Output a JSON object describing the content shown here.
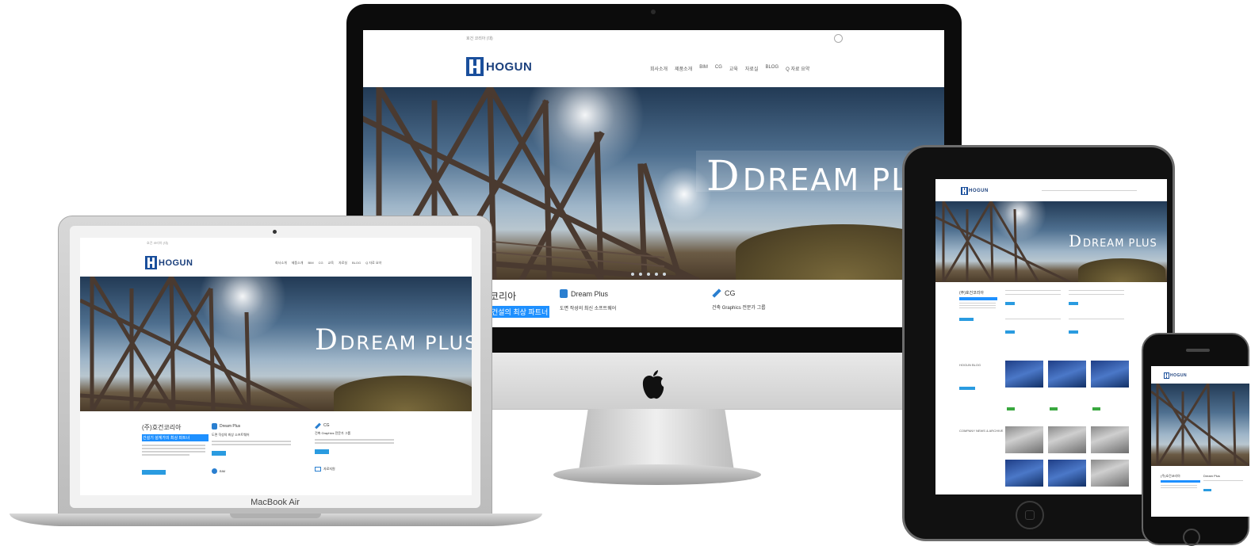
{
  "site": {
    "logo_text": "HOGUN",
    "topbar_text": "호건 코리아 (대)",
    "nav": [
      "회사소개",
      "제품소개",
      "BIM",
      "CG",
      "교육",
      "자료실",
      "BLOG",
      "Q 자료 요약"
    ],
    "hero_title_letter": "D",
    "hero_title_word_imac": "DREAM PLU",
    "hero_title_word": "DREAM PLUS"
  },
  "imac": {
    "features": [
      {
        "icon": "thumbs-up-icon",
        "title": "코리아",
        "subtitle": "건설의 최상 파트너"
      },
      {
        "icon": "thumbs-up-icon",
        "title": "Dream Plus",
        "subtitle": "도면 작성의 최신 소프트웨어"
      },
      {
        "icon": "brush-icon",
        "title": "CG",
        "subtitle": "건축 Graphics 전문가 그룹"
      }
    ]
  },
  "macbook": {
    "label": "MacBook Air",
    "company_title": "(주)호건코리아",
    "company_highlight": "건설기 설계가의 최상 파트너",
    "features": [
      {
        "title": "Dream Plus",
        "subtitle": "도면 작성의 최상 소프트웨어"
      },
      {
        "title": "CG",
        "subtitle": "건축 Graphics 전문가 그룹"
      },
      {
        "title": "BIM",
        "subtitle": ""
      },
      {
        "title": "자료지원",
        "subtitle": ""
      }
    ]
  },
  "ipad": {
    "company_title": "(주)호건코리아",
    "sections": [
      "HOGUN BLOG",
      "COMPANY NEWS & ARCHIVE"
    ]
  },
  "iphone": {
    "company_title": "(주)호건코리아",
    "feature": "Dream Plus"
  },
  "colors": {
    "brand_blue": "#1a4f9c",
    "highlight_blue": "#1e90ff",
    "button_blue": "#2a9be0",
    "device_black": "#0c0c0c"
  }
}
